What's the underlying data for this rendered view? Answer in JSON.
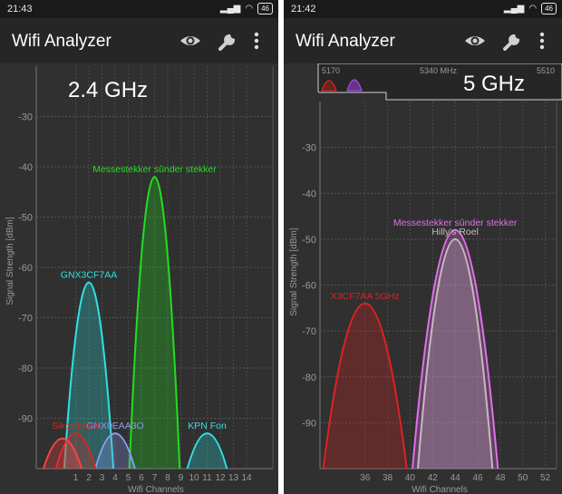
{
  "screens": [
    {
      "id": "left",
      "status": {
        "time": "21:43",
        "battery": "46"
      },
      "app_title": "Wifi Analyzer",
      "band_label": "2.4 GHz"
    },
    {
      "id": "right",
      "status": {
        "time": "21:42",
        "battery": "46"
      },
      "app_title": "Wifi Analyzer",
      "band_label": "5 GHz",
      "overview": {
        "ticks": [
          "5170",
          "5340 MHz",
          "5510"
        ]
      }
    }
  ],
  "icons": {
    "view": "eye-icon",
    "filter": "wrench-icon",
    "menu": "overflow-menu-icon"
  },
  "colors": {
    "background": "#303030",
    "appbar": "#262626",
    "grid": "#555555",
    "axis_text": "#9a9a9a"
  },
  "chart_data": [
    {
      "type": "area",
      "band": "2.4 GHz",
      "xlabel": "Wifi Channels",
      "ylabel": "Signal Strength [dBm]",
      "ylim": [
        -100,
        -20
      ],
      "xlim": [
        -2,
        16
      ],
      "x_ticks": [
        "1",
        "2",
        "3",
        "4",
        "5",
        "6",
        "7",
        "8",
        "9",
        "10",
        "11",
        "12",
        "13",
        "14"
      ],
      "y_ticks": [
        "-30",
        "-40",
        "-50",
        "-60",
        "-70",
        "-80",
        "-90"
      ],
      "grid": true,
      "series": [
        {
          "name": "Messestekker sûnder stekker",
          "center": 7,
          "width": 4,
          "peak": -42,
          "color": "#22dd22"
        },
        {
          "name": "GNX3CF7AA",
          "center": 2,
          "width": 4,
          "peak": -63,
          "color": "#30e0e0"
        },
        {
          "name": "GNX0EAA3O",
          "center": 4,
          "width": 4,
          "peak": -93,
          "color": "#8a9cf0"
        },
        {
          "name": "KPN Fon",
          "center": 11,
          "width": 4,
          "peak": -93,
          "color": "#30e0e0"
        },
        {
          "name": "Sikos black",
          "center": 1,
          "width": 4,
          "peak": -93,
          "color": "#dd2222"
        },
        {
          "name": "",
          "center": 0,
          "width": 4,
          "peak": -94,
          "color": "#ff4444"
        }
      ]
    },
    {
      "type": "area",
      "band": "5 GHz",
      "xlabel": "Wifi Channels",
      "ylabel": "Signal Strength [dBm]",
      "ylim": [
        -100,
        -20
      ],
      "xlim": [
        32,
        53
      ],
      "x_ticks": [
        "36",
        "38",
        "40",
        "42",
        "44",
        "46",
        "48",
        "50",
        "52"
      ],
      "y_ticks": [
        "-30",
        "-40",
        "-50",
        "-60",
        "-70",
        "-80",
        "-90"
      ],
      "grid": true,
      "series": [
        {
          "name": "Messestekker sûnder stekker",
          "center": 44,
          "width": 8,
          "peak": -48,
          "color": "#e070e8"
        },
        {
          "name": "Hilly's Roel",
          "center": 44,
          "width": 7,
          "peak": -50,
          "color": "#c8b8c0"
        },
        {
          "name": "X3CF7AA 5GHz",
          "center": 36,
          "width": 8,
          "peak": -64,
          "color": "#dd2222"
        }
      ]
    }
  ]
}
